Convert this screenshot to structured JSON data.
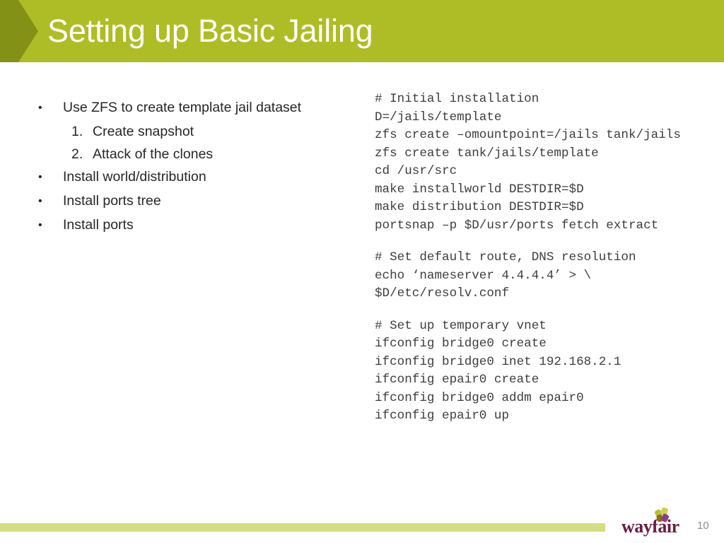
{
  "slide": {
    "title": "Setting up Basic Jailing",
    "page_number": "10",
    "colors": {
      "title_bar_green": "#aebd25",
      "title_chevron_green": "#839117",
      "footer_bar_green": "#d5dd83",
      "logo_wordmark_purple": "#6b1d3f",
      "body_text": "#262626",
      "code_text": "#3d3d3d",
      "page_number_gray": "#8e8e8e"
    }
  },
  "bullets": [
    {
      "level": 1,
      "marker": "•",
      "label": "Use ZFS to create template jail dataset"
    },
    {
      "level": 2,
      "marker": "1.",
      "label": "Create snapshot"
    },
    {
      "level": 2,
      "marker": "2.",
      "label": "Attack of the clones"
    },
    {
      "level": 1,
      "marker": "•",
      "label": "Install world/distribution"
    },
    {
      "level": 1,
      "marker": "•",
      "label": "Install ports tree"
    },
    {
      "level": 1,
      "marker": "•",
      "label": "Install ports"
    }
  ],
  "code_blocks": [
    {
      "lines": [
        "# Initial installation",
        "D=/jails/template",
        "zfs create –omountpoint=/jails tank/jails",
        "zfs create tank/jails/template",
        "cd /usr/src",
        "make installworld DESTDIR=$D",
        "make distribution DESTDIR=$D",
        "portsnap –p $D/usr/ports fetch extract"
      ]
    },
    {
      "lines": [
        "# Set default route, DNS resolution",
        "echo ‘nameserver 4.4.4.4’ > \\",
        "$D/etc/resolv.conf"
      ]
    },
    {
      "lines": [
        "# Set up temporary vnet",
        "ifconfig bridge0 create",
        "ifconfig bridge0 inet 192.168.2.1",
        "ifconfig epair0 create",
        "ifconfig bridge0 addm epair0",
        "ifconfig epair0 up"
      ]
    }
  ],
  "logo": {
    "wordmark": "wayfair"
  }
}
